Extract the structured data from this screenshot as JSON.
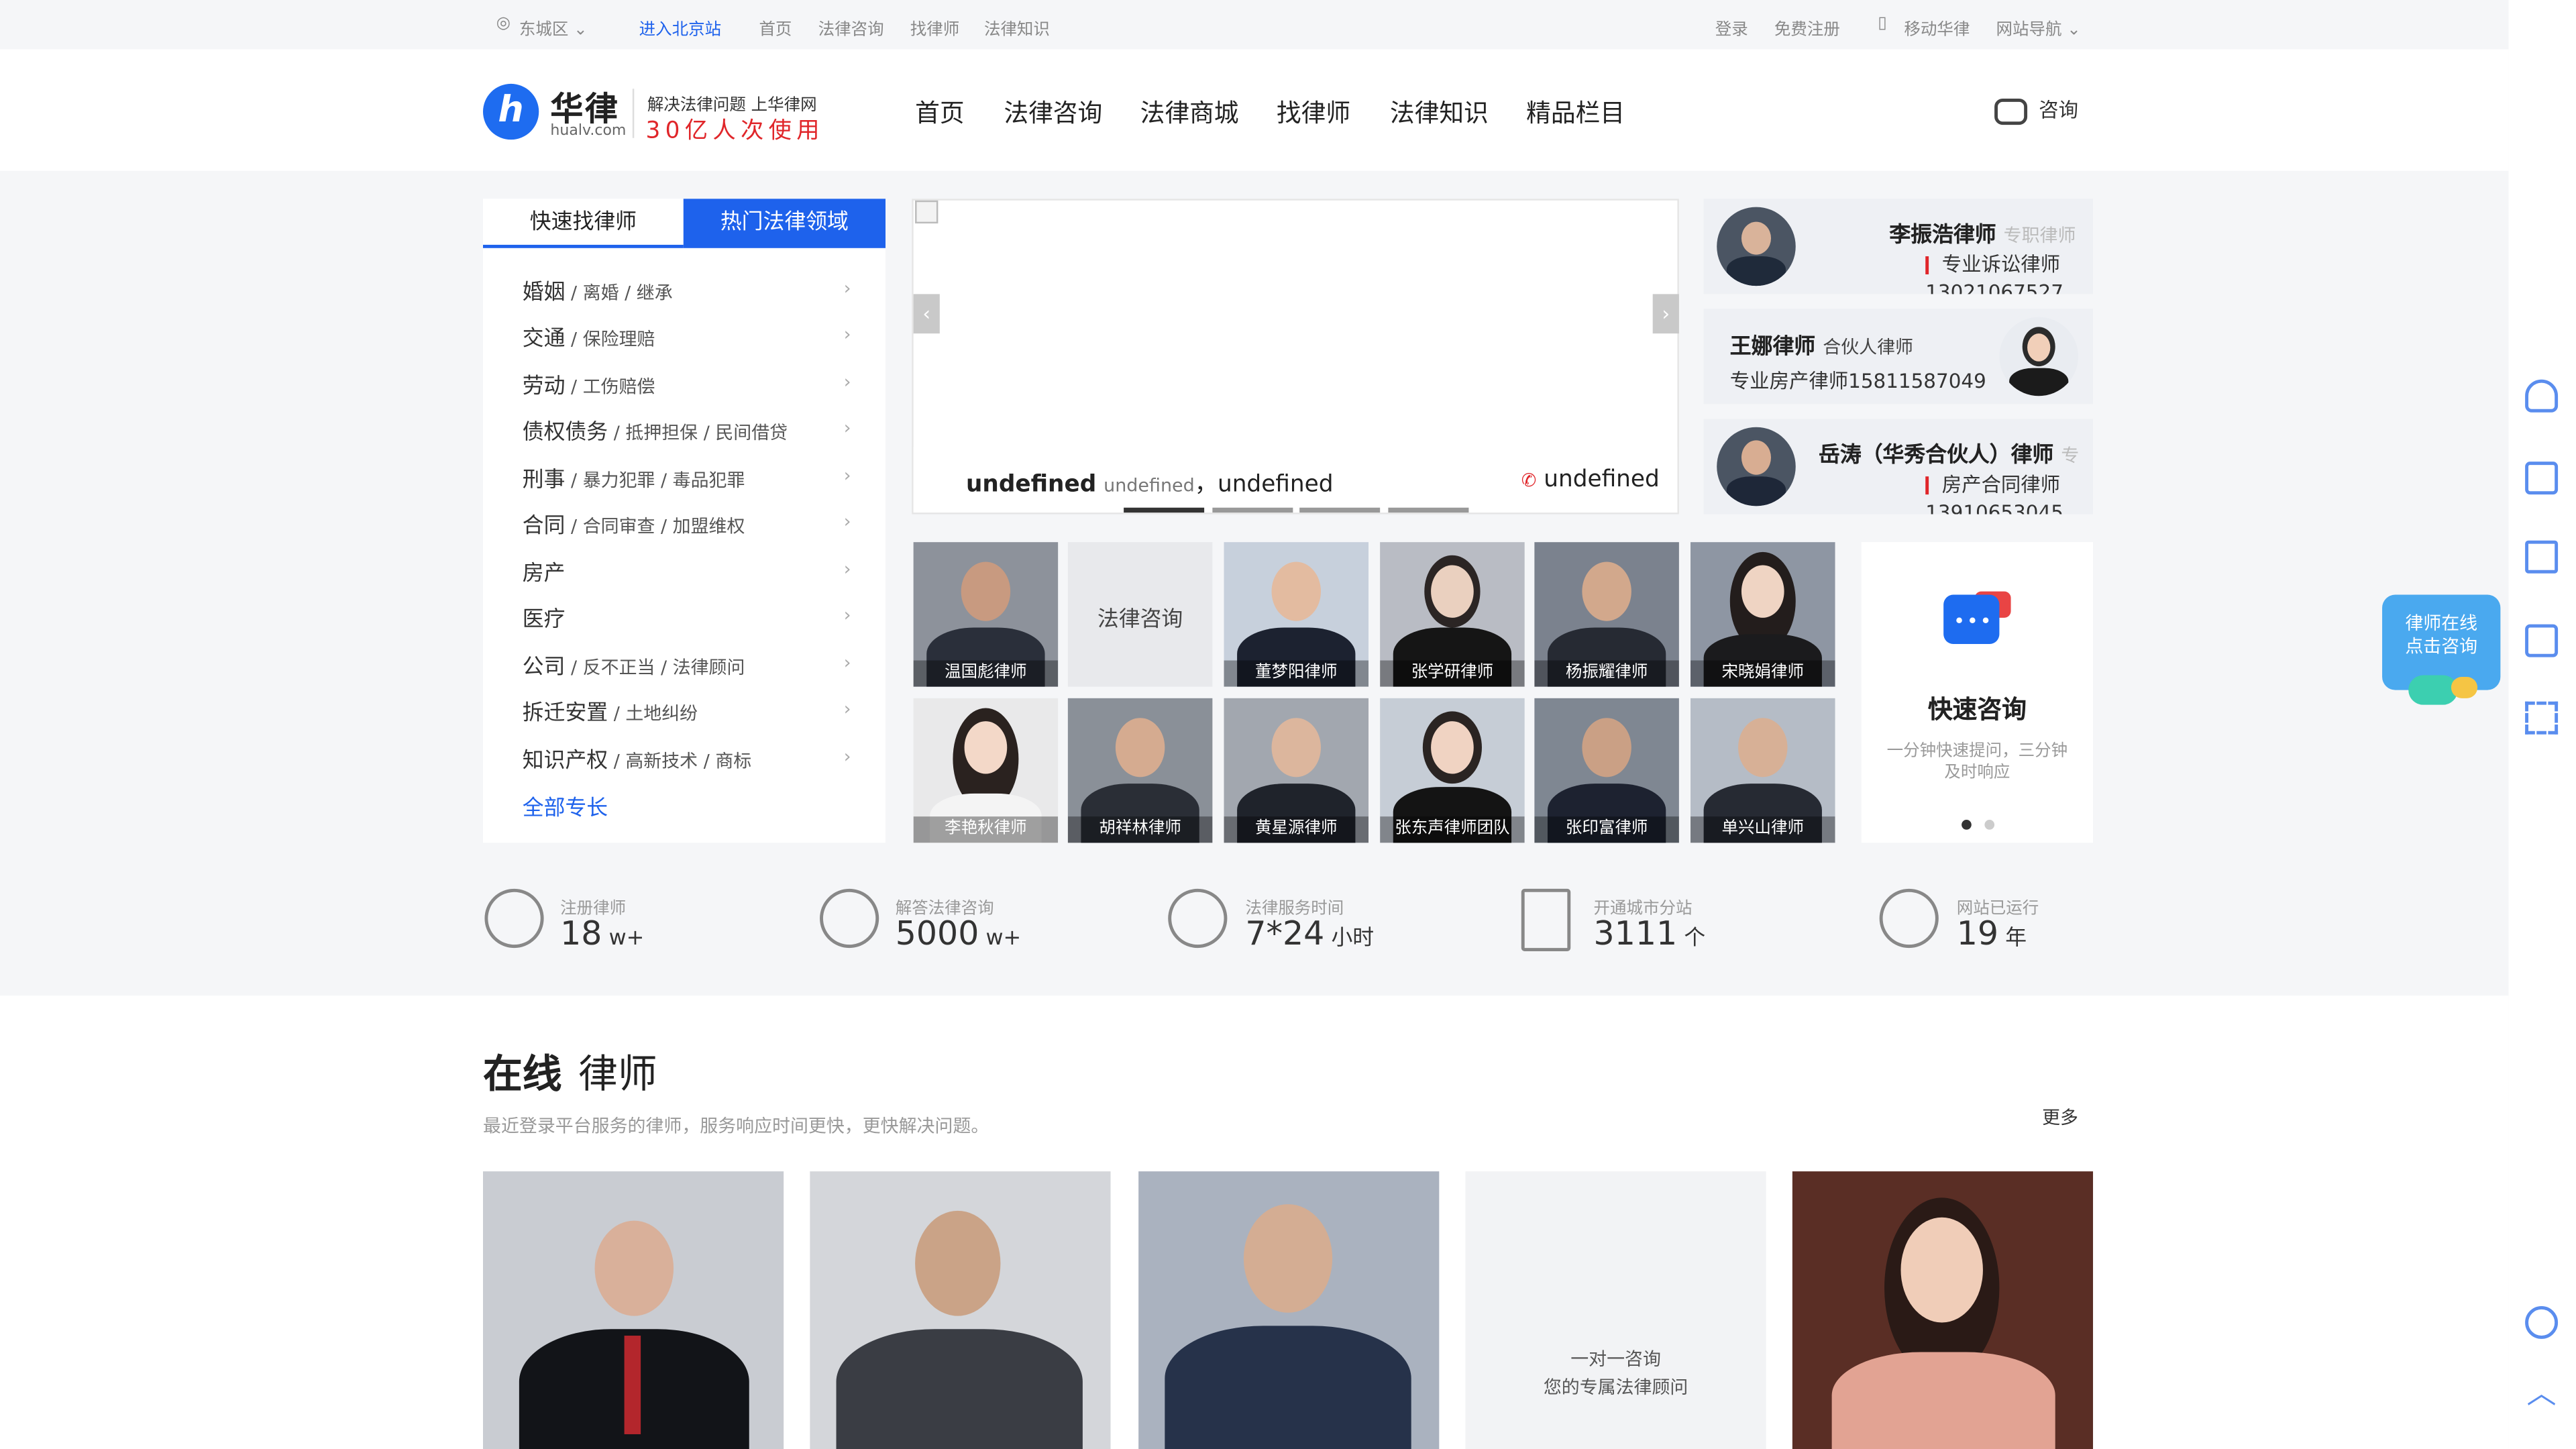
{
  "topbar": {
    "location": "东城区",
    "city_link": "进入北京站",
    "links": [
      "首页",
      "法律咨询",
      "找律师",
      "法律知识"
    ],
    "login": "登录",
    "register": "免费注册",
    "mobile": "移动华律",
    "site_nav": "网站导航"
  },
  "header": {
    "logo_char": "ℎ",
    "logo_name": "华律",
    "logo_domain": "hualv.com",
    "slogan_line1": "解决法律问题 上华律网",
    "slogan_line2": "30亿人次使用",
    "nav": [
      "首页",
      "法律咨询",
      "法律商城",
      "找律师",
      "法律知识",
      "精品栏目"
    ],
    "consult": "咨询"
  },
  "categories": {
    "tabs": [
      "快速找律师",
      "热门法律领域"
    ],
    "items": [
      {
        "main": "婚姻",
        "sub": " / 离婚 / 继承"
      },
      {
        "main": "交通",
        "sub": " / 保险理赔"
      },
      {
        "main": "劳动",
        "sub": " / 工伤赔偿"
      },
      {
        "main": "债权债务",
        "sub": " / 抵押担保 / 民间借贷"
      },
      {
        "main": "刑事",
        "sub": " / 暴力犯罪 / 毒品犯罪"
      },
      {
        "main": "合同",
        "sub": " / 合同审查 / 加盟维权"
      },
      {
        "main": "房产",
        "sub": ""
      },
      {
        "main": "医疗",
        "sub": ""
      },
      {
        "main": "公司",
        "sub": " / 反不正当 / 法律顾问"
      },
      {
        "main": "拆迁安置",
        "sub": " / 土地纠纷"
      },
      {
        "main": "知识产权",
        "sub": " / 高新技术 / 商标"
      }
    ],
    "all": "全部专长"
  },
  "banner": {
    "name": "undefined",
    "title": "undefined",
    "sep": "，",
    "field": "undefined",
    "phone": "undefined",
    "prev": "‹",
    "next": "›"
  },
  "featured": [
    {
      "name": "李振浩律师",
      "role": "专职律师",
      "desc": "专业诉讼律师",
      "phone": "13021067527"
    },
    {
      "name": "王娜律师",
      "role": "合伙人律师",
      "desc": "专业房产律师15811587049"
    },
    {
      "name": "岳涛（华秀合伙人）律师",
      "role": "专",
      "desc": "房产合同律师",
      "phone": "13910653045"
    }
  ],
  "tiles": [
    "温国彪律师",
    "法律咨询",
    "董梦阳律师",
    "张学研律师",
    "杨振耀律师",
    "宋晓娟律师",
    "李艳秋律师",
    "胡祥林律师",
    "黄星源律师",
    "张东声律师团队",
    "张印富律师",
    "单兴山律师"
  ],
  "quick": {
    "title": "快速咨询",
    "desc": "一分钟快速提问，三分钟及时响应"
  },
  "stats": [
    {
      "label": "注册律师",
      "value": "18",
      "unit": " w+"
    },
    {
      "label": "解答法律咨询",
      "value": "5000",
      "unit": " w+"
    },
    {
      "label": "法律服务时间",
      "value": "7*24",
      "unit": " 小时"
    },
    {
      "label": "开通城市分站",
      "value": "3111",
      "unit": " 个"
    },
    {
      "label": "网站已运行",
      "value": "19",
      "unit": " 年"
    }
  ],
  "online": {
    "title_bold": "在线",
    "title_rest": "律师",
    "subtitle": "最近登录平台服务的律师，服务响应时间更快，更快解决问题。",
    "more": "更多",
    "center_line1": "一对一咨询",
    "center_line2": "您的专属法律顾问"
  },
  "float": {
    "line1": "律师在线",
    "line2": "点击咨询"
  },
  "colors": {
    "accent": "#1e62ec",
    "brand_red": "#e0262a"
  }
}
